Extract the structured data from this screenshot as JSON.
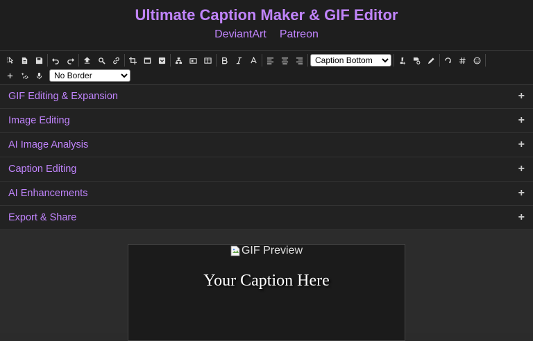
{
  "header": {
    "title": "Ultimate Caption Maker & GIF Editor",
    "links": [
      "DeviantArt",
      "Patreon"
    ]
  },
  "toolbar": {
    "caption_position": {
      "selected": "Caption Bottom"
    },
    "border": {
      "selected": "No Border"
    },
    "icons_row1": [
      "select-tool-icon",
      "new-file-icon",
      "save-icon",
      "undo-icon",
      "redo-icon",
      "upload-icon",
      "search-icon",
      "link-icon",
      "crop-icon",
      "frame-icon",
      "dropdown-box-icon",
      "tree-icon",
      "resize-icon",
      "split-icon",
      "bold-icon",
      "italic-icon",
      "font-color-icon",
      "align-left-icon",
      "align-center-icon",
      "align-right-icon",
      "brush-plus-icon",
      "image-settings-icon",
      "pencil-icon",
      "rotate-icon",
      "hashtag-icon",
      "smiley-icon"
    ],
    "icons_row2": [
      "add-icon",
      "sparkle-link-icon",
      "microphone-icon"
    ]
  },
  "accordion": [
    {
      "label": "GIF Editing & Expansion",
      "toggle": "+"
    },
    {
      "label": "Image Editing",
      "toggle": "+"
    },
    {
      "label": "AI Image Analysis",
      "toggle": "+"
    },
    {
      "label": "Caption Editing",
      "toggle": "+"
    },
    {
      "label": "AI Enhancements",
      "toggle": "+"
    },
    {
      "label": "Export & Share",
      "toggle": "+"
    }
  ],
  "preview": {
    "image_alt": "GIF Preview",
    "caption": "Your Caption Here"
  }
}
